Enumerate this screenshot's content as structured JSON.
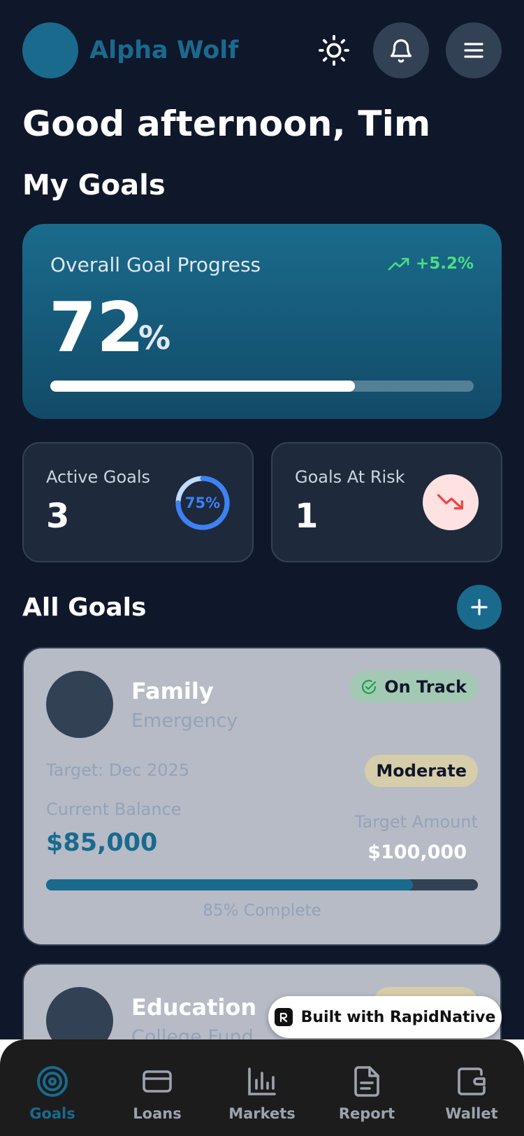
{
  "header": {
    "brand": "Alpha Wolf",
    "icons": [
      "sun-icon",
      "bell-icon",
      "menu-icon"
    ]
  },
  "greeting": "Good afternoon, Tim",
  "section_title": "My Goals",
  "overall": {
    "label": "Overall Goal Progress",
    "trend": "+5.2%",
    "value": "72",
    "unit": "%",
    "progress_fraction": 0.72,
    "accent": "#4ade80"
  },
  "stats": {
    "active": {
      "label": "Active Goals",
      "value": "3",
      "ring_text": "75%",
      "ring_fraction": 0.75
    },
    "risk": {
      "label": "Goals At Risk",
      "value": "1"
    }
  },
  "all_goals": {
    "title": "All Goals",
    "goals": [
      {
        "name": "Family",
        "subtitle": "Emergency",
        "status": "On Track",
        "target_date": "Target: Dec 2025",
        "risk": "Moderate",
        "current_label": "Current Balance",
        "current_value": "$85,000",
        "target_label": "Target Amount",
        "target_value": "$100,000",
        "progress_fraction": 0.85,
        "complete_text": "85% Complete"
      },
      {
        "name": "Education",
        "subtitle": "College Fund"
      }
    ]
  },
  "badge": {
    "text": "Built with RapidNative"
  },
  "tabs": [
    {
      "label": "Goals",
      "icon": "target-icon",
      "active": true
    },
    {
      "label": "Loans",
      "icon": "card-icon",
      "active": false
    },
    {
      "label": "Markets",
      "icon": "bar-chart-icon",
      "active": false
    },
    {
      "label": "Report",
      "icon": "document-icon",
      "active": false
    },
    {
      "label": "Wallet",
      "icon": "wallet-icon",
      "active": false
    }
  ],
  "colors": {
    "background": "#0f172a",
    "brand": "#1a6a8e",
    "card": "#1e293b",
    "positive": "#4ade80",
    "negative": "#ef4444"
  }
}
